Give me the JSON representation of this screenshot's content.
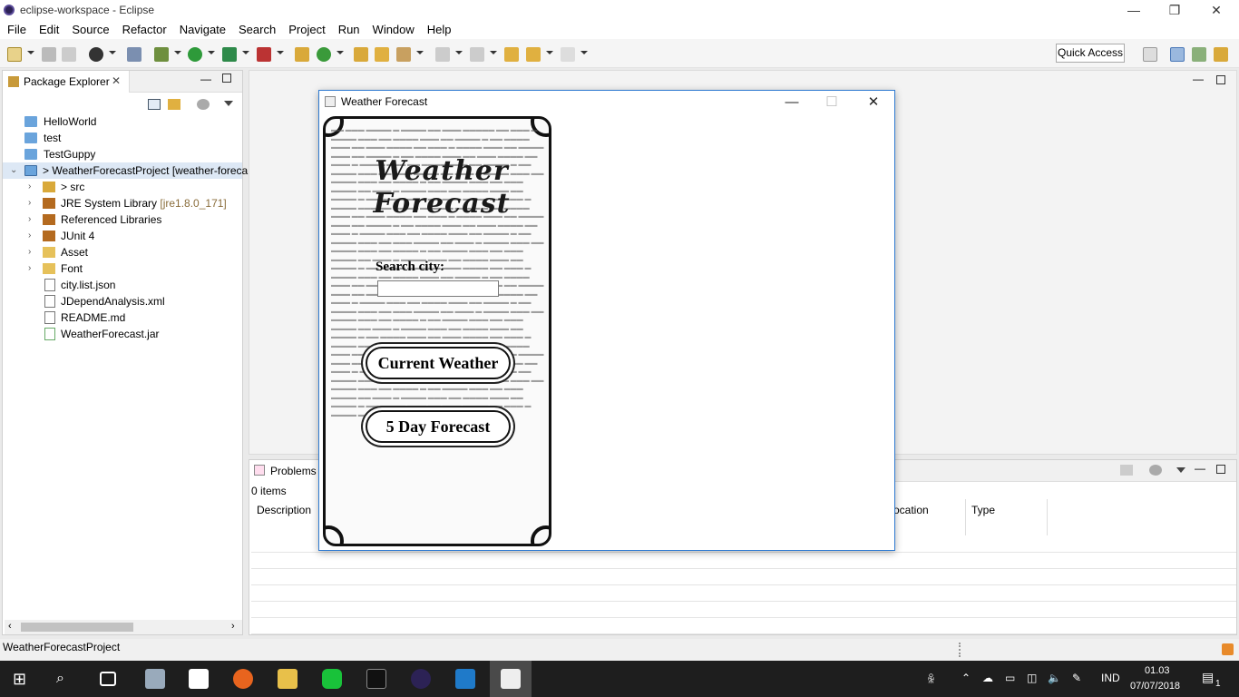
{
  "window": {
    "title": "eclipse-workspace - Eclipse"
  },
  "menu": [
    "File",
    "Edit",
    "Source",
    "Refactor",
    "Navigate",
    "Search",
    "Project",
    "Run",
    "Window",
    "Help"
  ],
  "toolbar": {
    "quick_access": "Quick Access"
  },
  "package_explorer": {
    "tab_label": "Package Explorer",
    "items": [
      {
        "label": "HelloWorld",
        "decoration": ""
      },
      {
        "label": "test",
        "decoration": ""
      },
      {
        "label": "TestGuppy",
        "decoration": ""
      },
      {
        "label": "> WeatherForecastProject [weather-foreca",
        "decoration": ""
      },
      {
        "label": "> src",
        "decoration": ""
      },
      {
        "label": "JRE System Library",
        "decoration": "[jre1.8.0_171]"
      },
      {
        "label": "Referenced Libraries",
        "decoration": ""
      },
      {
        "label": "JUnit 4",
        "decoration": ""
      },
      {
        "label": "Asset",
        "decoration": ""
      },
      {
        "label": "Font",
        "decoration": ""
      },
      {
        "label": "city.list.json",
        "decoration": ""
      },
      {
        "label": "JDependAnalysis.xml",
        "decoration": ""
      },
      {
        "label": "README.md",
        "decoration": ""
      },
      {
        "label": "WeatherForecast.jar",
        "decoration": ""
      }
    ]
  },
  "problems": {
    "tab_label": "Problems",
    "count": "0 items",
    "columns": [
      "Description",
      "Location",
      "Type"
    ],
    "column_partial": "ocation"
  },
  "status": {
    "text": "WeatherForecastProject"
  },
  "dialog": {
    "title": "Weather Forecast",
    "app_title": "Weather Forecast",
    "search_label": "Search city:",
    "search_value": "",
    "current_weather_button": "Current Weather",
    "five_day_button": "5 Day Forecast"
  },
  "taskbar": {
    "lang": "IND",
    "time": "01.03",
    "date": "07/07/2018",
    "notif_count": "1"
  }
}
